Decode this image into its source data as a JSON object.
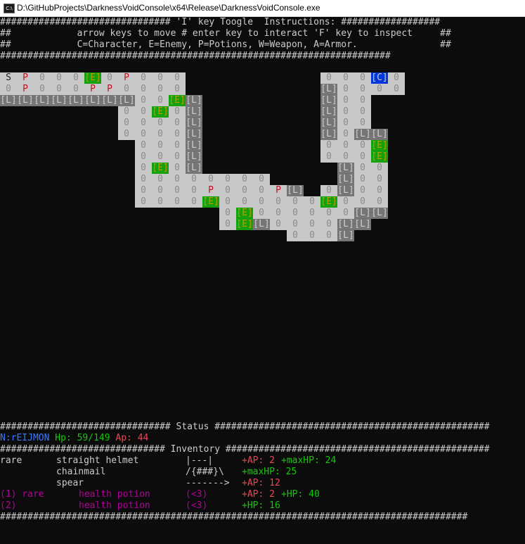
{
  "window": {
    "title": "D:\\GitHubProjects\\DarknessVoidConsole\\x64\\Release\\DarknessVoidConsole.exe",
    "icon": "console-app-icon",
    "icon_glyph": "C:\\"
  },
  "colors": {
    "background": "#0c0c0c",
    "default_text": "#cccccc",
    "red": "#e74856",
    "green": "#13a10e",
    "blue": "#3b78ff",
    "purple": "#881798",
    "yellow": "#c19c00",
    "floor": "#c8c8c8",
    "loot": "#767676",
    "character": "#0037da"
  },
  "instructions": [
    "############################### 'I' key Toogle  Instructions: ##################",
    "##            arrow keys to move # enter key to interact 'F' key to inspect     ##",
    "##            C=Character, E=Enemy, P=Potions, W=Weapon, A=Armor.               ##",
    "#######################################################################"
  ],
  "map": [
    "S P 0 0 0 E 0 P 0 0 0                               0 0 0 C 0",
    "0 P 0 0 0 P P 0 0 0 0                               L 0 0 0 0",
    "L L L L L L L L 0 0 E L                             L 0 0",
    "                    0 E 0 L                             L 0 0",
    "                    0 0 0 L                             L 0 0",
    "                    0 0 0 L                             L 0 L L",
    "                        0 0 0 L                         0 0 0 E",
    "                        0 0 0 L                         0 0 0 E",
    "                        0 E 0 L                             L 0 0",
    "                        0 0 0 0 0 0 0 0                     L 0 0",
    "                        0 0 0 0 P 0 0 0 P L           0 L 0 0",
    "                        0 0 0 0 E 0 0 0 0 0 0 E 0 0 0",
    "                                        0 E 0 0 0 0 0 0 0 L L",
    "                                        0 E L 0 0 0 0 L L",
    "                                                    0 0 0 L"
  ],
  "map_cells": [
    {
      "row": 0,
      "col": 0,
      "t": "S"
    },
    {
      "row": 0,
      "col": 1,
      "t": "P"
    },
    {
      "row": 0,
      "col": 2,
      "t": "0"
    },
    {
      "row": 0,
      "col": 3,
      "t": "0"
    },
    {
      "row": 0,
      "col": 4,
      "t": "0"
    },
    {
      "row": 0,
      "col": 5,
      "t": "E"
    },
    {
      "row": 0,
      "col": 6,
      "t": "0"
    },
    {
      "row": 0,
      "col": 7,
      "t": "P"
    },
    {
      "row": 0,
      "col": 8,
      "t": "0"
    },
    {
      "row": 0,
      "col": 9,
      "t": "0"
    },
    {
      "row": 0,
      "col": 10,
      "t": "0"
    },
    {
      "row": 0,
      "col": 19,
      "t": "0"
    },
    {
      "row": 0,
      "col": 20,
      "t": "0"
    },
    {
      "row": 0,
      "col": 21,
      "t": "0"
    },
    {
      "row": 0,
      "col": 22,
      "t": "C"
    },
    {
      "row": 0,
      "col": 23,
      "t": "0"
    },
    {
      "row": 1,
      "col": 0,
      "t": "0"
    },
    {
      "row": 1,
      "col": 1,
      "t": "P"
    },
    {
      "row": 1,
      "col": 2,
      "t": "0"
    },
    {
      "row": 1,
      "col": 3,
      "t": "0"
    },
    {
      "row": 1,
      "col": 4,
      "t": "0"
    },
    {
      "row": 1,
      "col": 5,
      "t": "P"
    },
    {
      "row": 1,
      "col": 6,
      "t": "P"
    },
    {
      "row": 1,
      "col": 7,
      "t": "0"
    },
    {
      "row": 1,
      "col": 8,
      "t": "0"
    },
    {
      "row": 1,
      "col": 9,
      "t": "0"
    },
    {
      "row": 1,
      "col": 10,
      "t": "0"
    },
    {
      "row": 1,
      "col": 19,
      "t": "L"
    },
    {
      "row": 1,
      "col": 20,
      "t": "0"
    },
    {
      "row": 1,
      "col": 21,
      "t": "0"
    },
    {
      "row": 1,
      "col": 22,
      "t": "0"
    },
    {
      "row": 1,
      "col": 23,
      "t": "0"
    },
    {
      "row": 2,
      "col": 0,
      "t": "L"
    },
    {
      "row": 2,
      "col": 1,
      "t": "L"
    },
    {
      "row": 2,
      "col": 2,
      "t": "L"
    },
    {
      "row": 2,
      "col": 3,
      "t": "L"
    },
    {
      "row": 2,
      "col": 4,
      "t": "L"
    },
    {
      "row": 2,
      "col": 5,
      "t": "L"
    },
    {
      "row": 2,
      "col": 6,
      "t": "L"
    },
    {
      "row": 2,
      "col": 7,
      "t": "L"
    },
    {
      "row": 2,
      "col": 8,
      "t": "0"
    },
    {
      "row": 2,
      "col": 9,
      "t": "0"
    },
    {
      "row": 2,
      "col": 10,
      "t": "E"
    },
    {
      "row": 2,
      "col": 11,
      "t": "L"
    },
    {
      "row": 2,
      "col": 19,
      "t": "L"
    },
    {
      "row": 2,
      "col": 20,
      "t": "0"
    },
    {
      "row": 2,
      "col": 21,
      "t": "0"
    },
    {
      "row": 3,
      "col": 7,
      "t": "0"
    },
    {
      "row": 3,
      "col": 8,
      "t": "0"
    },
    {
      "row": 3,
      "col": 9,
      "t": "E"
    },
    {
      "row": 3,
      "col": 10,
      "t": "0"
    },
    {
      "row": 3,
      "col": 11,
      "t": "L"
    },
    {
      "row": 3,
      "col": 19,
      "t": "L"
    },
    {
      "row": 3,
      "col": 20,
      "t": "0"
    },
    {
      "row": 3,
      "col": 21,
      "t": "0"
    },
    {
      "row": 4,
      "col": 7,
      "t": "0"
    },
    {
      "row": 4,
      "col": 8,
      "t": "0"
    },
    {
      "row": 4,
      "col": 9,
      "t": "0"
    },
    {
      "row": 4,
      "col": 10,
      "t": "0"
    },
    {
      "row": 4,
      "col": 11,
      "t": "L"
    },
    {
      "row": 4,
      "col": 19,
      "t": "L"
    },
    {
      "row": 4,
      "col": 20,
      "t": "0"
    },
    {
      "row": 4,
      "col": 21,
      "t": "0"
    },
    {
      "row": 5,
      "col": 7,
      "t": "0"
    },
    {
      "row": 5,
      "col": 8,
      "t": "0"
    },
    {
      "row": 5,
      "col": 9,
      "t": "0"
    },
    {
      "row": 5,
      "col": 10,
      "t": "0"
    },
    {
      "row": 5,
      "col": 11,
      "t": "L"
    },
    {
      "row": 5,
      "col": 19,
      "t": "L"
    },
    {
      "row": 5,
      "col": 20,
      "t": "0"
    },
    {
      "row": 5,
      "col": 21,
      "t": "L"
    },
    {
      "row": 5,
      "col": 22,
      "t": "L"
    },
    {
      "row": 6,
      "col": 8,
      "t": "0"
    },
    {
      "row": 6,
      "col": 9,
      "t": "0"
    },
    {
      "row": 6,
      "col": 10,
      "t": "0"
    },
    {
      "row": 6,
      "col": 11,
      "t": "L"
    },
    {
      "row": 6,
      "col": 19,
      "t": "0"
    },
    {
      "row": 6,
      "col": 20,
      "t": "0"
    },
    {
      "row": 6,
      "col": 21,
      "t": "0"
    },
    {
      "row": 6,
      "col": 22,
      "t": "E"
    },
    {
      "row": 7,
      "col": 8,
      "t": "0"
    },
    {
      "row": 7,
      "col": 9,
      "t": "0"
    },
    {
      "row": 7,
      "col": 10,
      "t": "0"
    },
    {
      "row": 7,
      "col": 11,
      "t": "L"
    },
    {
      "row": 7,
      "col": 19,
      "t": "0"
    },
    {
      "row": 7,
      "col": 20,
      "t": "0"
    },
    {
      "row": 7,
      "col": 21,
      "t": "0"
    },
    {
      "row": 7,
      "col": 22,
      "t": "E"
    },
    {
      "row": 8,
      "col": 8,
      "t": "0"
    },
    {
      "row": 8,
      "col": 9,
      "t": "E"
    },
    {
      "row": 8,
      "col": 10,
      "t": "0"
    },
    {
      "row": 8,
      "col": 11,
      "t": "L"
    },
    {
      "row": 8,
      "col": 20,
      "t": "L"
    },
    {
      "row": 8,
      "col": 21,
      "t": "0"
    },
    {
      "row": 8,
      "col": 22,
      "t": "0"
    },
    {
      "row": 9,
      "col": 8,
      "t": "0"
    },
    {
      "row": 9,
      "col": 9,
      "t": "0"
    },
    {
      "row": 9,
      "col": 10,
      "t": "0"
    },
    {
      "row": 9,
      "col": 11,
      "t": "0"
    },
    {
      "row": 9,
      "col": 12,
      "t": "0"
    },
    {
      "row": 9,
      "col": 13,
      "t": "0"
    },
    {
      "row": 9,
      "col": 14,
      "t": "0"
    },
    {
      "row": 9,
      "col": 15,
      "t": "0"
    },
    {
      "row": 9,
      "col": 20,
      "t": "L"
    },
    {
      "row": 9,
      "col": 21,
      "t": "0"
    },
    {
      "row": 9,
      "col": 22,
      "t": "0"
    },
    {
      "row": 10,
      "col": 8,
      "t": "0"
    },
    {
      "row": 10,
      "col": 9,
      "t": "0"
    },
    {
      "row": 10,
      "col": 10,
      "t": "0"
    },
    {
      "row": 10,
      "col": 11,
      "t": "0"
    },
    {
      "row": 10,
      "col": 12,
      "t": "P"
    },
    {
      "row": 10,
      "col": 13,
      "t": "0"
    },
    {
      "row": 10,
      "col": 14,
      "t": "0"
    },
    {
      "row": 10,
      "col": 15,
      "t": "0"
    },
    {
      "row": 10,
      "col": 16,
      "t": "P"
    },
    {
      "row": 10,
      "col": 17,
      "t": "L"
    },
    {
      "row": 10,
      "col": 19,
      "t": "0"
    },
    {
      "row": 10,
      "col": 20,
      "t": "L"
    },
    {
      "row": 10,
      "col": 21,
      "t": "0"
    },
    {
      "row": 10,
      "col": 22,
      "t": "0"
    },
    {
      "row": 11,
      "col": 8,
      "t": "0"
    },
    {
      "row": 11,
      "col": 9,
      "t": "0"
    },
    {
      "row": 11,
      "col": 10,
      "t": "0"
    },
    {
      "row": 11,
      "col": 11,
      "t": "0"
    },
    {
      "row": 11,
      "col": 12,
      "t": "E"
    },
    {
      "row": 11,
      "col": 13,
      "t": "0"
    },
    {
      "row": 11,
      "col": 14,
      "t": "0"
    },
    {
      "row": 11,
      "col": 15,
      "t": "0"
    },
    {
      "row": 11,
      "col": 16,
      "t": "0"
    },
    {
      "row": 11,
      "col": 17,
      "t": "0"
    },
    {
      "row": 11,
      "col": 18,
      "t": "0"
    },
    {
      "row": 11,
      "col": 19,
      "t": "E"
    },
    {
      "row": 11,
      "col": 20,
      "t": "0"
    },
    {
      "row": 11,
      "col": 21,
      "t": "0"
    },
    {
      "row": 11,
      "col": 22,
      "t": "0"
    },
    {
      "row": 12,
      "col": 13,
      "t": "0"
    },
    {
      "row": 12,
      "col": 14,
      "t": "E"
    },
    {
      "row": 12,
      "col": 15,
      "t": "0"
    },
    {
      "row": 12,
      "col": 16,
      "t": "0"
    },
    {
      "row": 12,
      "col": 17,
      "t": "0"
    },
    {
      "row": 12,
      "col": 18,
      "t": "0"
    },
    {
      "row": 12,
      "col": 19,
      "t": "0"
    },
    {
      "row": 12,
      "col": 20,
      "t": "0"
    },
    {
      "row": 12,
      "col": 21,
      "t": "L"
    },
    {
      "row": 12,
      "col": 22,
      "t": "L"
    },
    {
      "row": 13,
      "col": 13,
      "t": "0"
    },
    {
      "row": 13,
      "col": 14,
      "t": "E"
    },
    {
      "row": 13,
      "col": 15,
      "t": "L"
    },
    {
      "row": 13,
      "col": 16,
      "t": "0"
    },
    {
      "row": 13,
      "col": 17,
      "t": "0"
    },
    {
      "row": 13,
      "col": 18,
      "t": "0"
    },
    {
      "row": 13,
      "col": 19,
      "t": "0"
    },
    {
      "row": 13,
      "col": 20,
      "t": "L"
    },
    {
      "row": 13,
      "col": 21,
      "t": "L"
    },
    {
      "row": 14,
      "col": 17,
      "t": "0"
    },
    {
      "row": 14,
      "col": 18,
      "t": "0"
    },
    {
      "row": 14,
      "col": 19,
      "t": "0"
    },
    {
      "row": 14,
      "col": 20,
      "t": "L"
    }
  ],
  "status": {
    "header": "############################### Status ##################################################",
    "name": "N:rEIJMON",
    "hp": "Hp: 59/149",
    "ap": "Ap: 44"
  },
  "inventory": {
    "header": "############################## Inventory ################################################",
    "rows": [
      {
        "tag": "rare",
        "name": "straight helmet",
        "art": "|---|",
        "stat1": "+AP: 2",
        "stat2": "+maxHP: 24",
        "purple": false
      },
      {
        "tag": "",
        "name": "chainmail",
        "art": "/{###}\\",
        "stat1": "",
        "stat2": "+maxHP: 25",
        "purple": false
      },
      {
        "tag": "",
        "name": "spear",
        "art": "------->",
        "stat1": "+AP: 12",
        "stat2": "",
        "purple": false
      },
      {
        "tag": "(1) rare",
        "name": "health potion",
        "art": "(<3)",
        "stat1": "+AP: 2",
        "stat2": "+HP: 40",
        "purple": true
      },
      {
        "tag": "(2)",
        "name": "health potion",
        "art": "(<3)",
        "stat1": "",
        "stat2": "+HP: 16",
        "purple": true
      }
    ],
    "footer": "#####################################################################################"
  }
}
